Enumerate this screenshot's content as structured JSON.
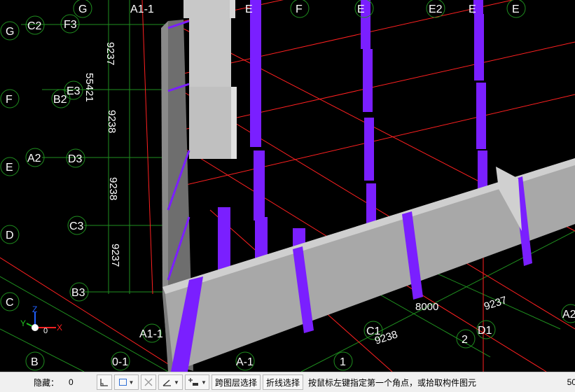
{
  "axes": {
    "top": [
      "G",
      "A1-1",
      "E",
      "F",
      "E",
      "E2",
      "E",
      "E"
    ],
    "left_circles": [
      "G",
      "F",
      "E",
      "D",
      "C",
      "B"
    ],
    "left_inner": [
      "C2",
      "F3",
      "B2",
      "E3",
      "A2",
      "D3",
      "C3",
      "B3"
    ],
    "bottom": [
      "A1-1",
      "0-1",
      "A-1",
      "1",
      "C1",
      "2",
      "D1",
      "A2"
    ]
  },
  "dimensions": {
    "left": [
      "9237",
      "55421",
      "9238",
      "9238",
      "9237"
    ],
    "bottom": [
      "8000",
      "9237",
      "9238"
    ]
  },
  "coordinate_indicator": {
    "x_label": "X",
    "y_label": "Y",
    "z_label": "Z",
    "extra": "0"
  },
  "colors": {
    "background": "#000000",
    "column": "#7a1fff",
    "slab": "#a8a8a8",
    "axis_line": "#ff2020",
    "grid_line": "#1f8f1f"
  },
  "statusbar": {
    "hidden_label": "隐藏：",
    "hidden_value": "0",
    "btn_cross_layer": "跨图层选择",
    "btn_polyline": "折线选择",
    "prompt": "按鼠标左键指定第一个角点，或拾取构件图元",
    "right_number": "50"
  },
  "icons": {
    "ortho": "ortho-mode-icon",
    "rect": "rect-select-icon",
    "cross": "cross-icon",
    "angle": "angle-icon",
    "snap": "snap-point-icon"
  }
}
